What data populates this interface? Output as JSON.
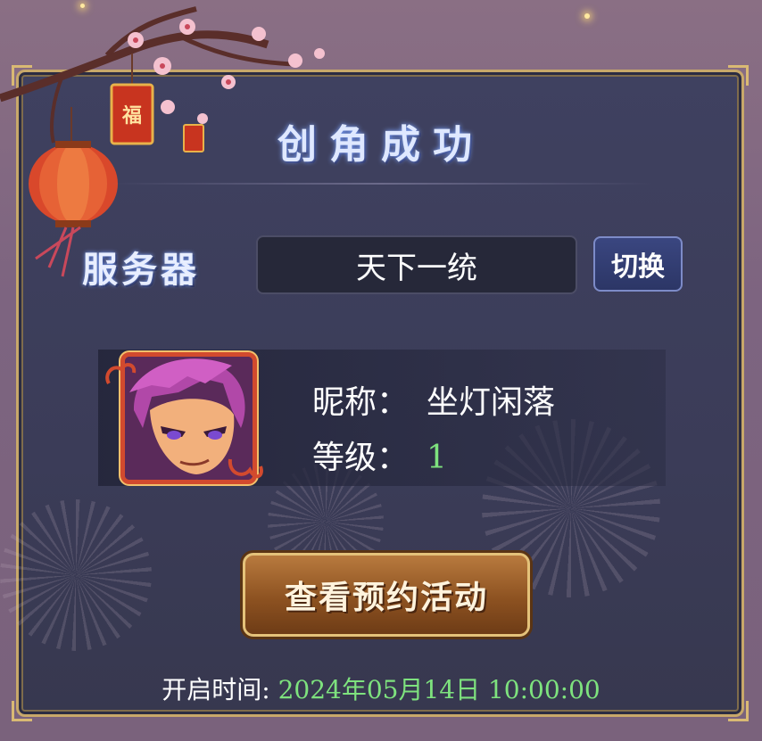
{
  "dialog": {
    "title": "创角成功",
    "server_label": "服务器",
    "server_value": "天下一统",
    "switch_label": "切换",
    "nickname_label": "昵称：",
    "nickname_value": "坐灯闲落",
    "level_label": "等级：",
    "level_value": "1",
    "action_label": "查看预约活动",
    "open_time_label": "开启时间:",
    "open_time_value": "2024年05月14日 10:00:00"
  },
  "decor": {
    "lantern_charm_text": "福",
    "avatar_icon": "character-portrait-icon"
  },
  "colors": {
    "panel": "#3b3c58",
    "gold_border": "#c8a86a",
    "level_green": "#7ee27e",
    "button_brown": "#8d5221",
    "lantern_red": "#d9482b"
  }
}
